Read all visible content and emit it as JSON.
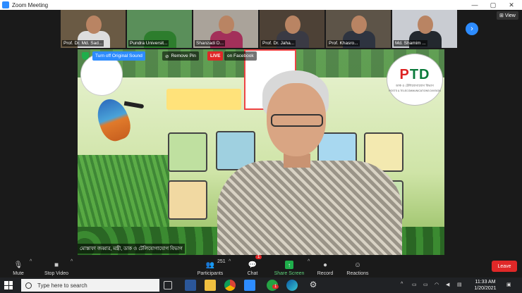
{
  "window": {
    "title": "Zoom Meeting"
  },
  "gallery": {
    "tiles": [
      {
        "name": "Prof. Dr. Md. Sad...",
        "bg": "#6a5a44",
        "shirt": "#ddd"
      },
      {
        "name": "Pundra Universit...",
        "bg": "#5a8f5a",
        "shirt": "#2d7d2d"
      },
      {
        "name": "Shanzadi  D...",
        "bg": "#aaa39a",
        "shirt": "#a3305a"
      },
      {
        "name": "Prof. Dr. Jaha...",
        "bg": "#4d4136",
        "shirt": "#3a3a44"
      },
      {
        "name": "Prof. Khasro...",
        "bg": "#5d5448",
        "shirt": "#2e3440"
      },
      {
        "name": "Md. Shamim ...",
        "bg": "#c9ccd2",
        "shirt": "#23282e"
      }
    ],
    "view_label": "View",
    "next_icon": "›"
  },
  "share_overlay": {
    "original_sound": "Turn off Original Sound",
    "remove_pin": "Remove Pin",
    "live_badge": "LIVE",
    "live_target": "on Facebook"
  },
  "presenter": {
    "caption": "মোস্তাফা জব্বার, মন্ত্রী, ডাক ও টেলিযোগাযোগ বিভাগ"
  },
  "logo": {
    "letters_left": "P",
    "letters_mid": "T",
    "letters_right": "D",
    "bangla": "ডাক ও টেলিযোগাযোগ বিভাগ",
    "english": "POSTS & TELECOMMUNICATIONS DIVISION"
  },
  "toolbar": {
    "mute": "Mute",
    "stop_video": "Stop Video",
    "participants": "Participants",
    "participants_count": "251",
    "chat": "Chat",
    "chat_badge": "1",
    "share_screen": "Share Screen",
    "record": "Record",
    "reactions": "Reactions",
    "leave": "Leave"
  },
  "taskbar": {
    "search_placeholder": "Type here to search",
    "time": "11:33 AM",
    "date": "1/20/2021",
    "app_badge": "1"
  }
}
